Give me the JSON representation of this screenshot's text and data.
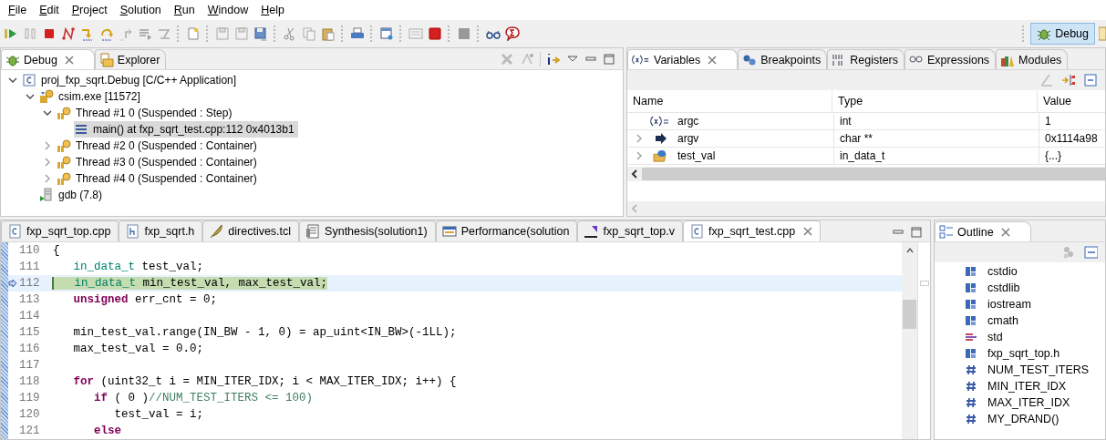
{
  "menu": [
    "File",
    "Edit",
    "Project",
    "Solution",
    "Run",
    "Window",
    "Help"
  ],
  "perspectives": [
    {
      "label": "Debug",
      "selected": true
    }
  ],
  "debug_view": {
    "tabs": [
      {
        "label": "Debug",
        "selected": true
      },
      {
        "label": "Explorer",
        "selected": false
      }
    ],
    "tree": [
      {
        "label": "proj_fxp_sqrt.Debug [C/C++ Application]",
        "kind": "launch",
        "expanded": true,
        "selected": false,
        "children": [
          {
            "label": "csim.exe [11572]",
            "kind": "process",
            "expanded": true,
            "selected": false,
            "children": [
              {
                "label": "Thread #1 0 (Suspended : Step)",
                "kind": "thread",
                "expanded": true,
                "selected": false,
                "children": [
                  {
                    "label": "main() at fxp_sqrt_test.cpp:112 0x4013b1",
                    "kind": "frame",
                    "selected": true
                  }
                ]
              },
              {
                "label": "Thread #2 0 (Suspended : Container)",
                "kind": "thread",
                "expanded": false,
                "selected": false
              },
              {
                "label": "Thread #3 0 (Suspended : Container)",
                "kind": "thread",
                "expanded": false,
                "selected": false
              },
              {
                "label": "Thread #4 0 (Suspended : Container)",
                "kind": "thread",
                "expanded": false,
                "selected": false
              }
            ]
          },
          {
            "label": "gdb (7.8)",
            "kind": "debugger",
            "selected": false
          }
        ]
      }
    ]
  },
  "variables_view": {
    "tabs": [
      {
        "label": "Variables",
        "kind": "variables",
        "selected": true
      },
      {
        "label": "Breakpoints",
        "kind": "breakpoints",
        "selected": false
      },
      {
        "label": "Registers",
        "kind": "registers",
        "selected": false
      },
      {
        "label": "Expressions",
        "kind": "expressions",
        "selected": false
      },
      {
        "label": "Modules",
        "kind": "modules",
        "selected": false
      }
    ],
    "columns": [
      "Name",
      "Type",
      "Value"
    ],
    "rows": [
      {
        "name": "argc",
        "type": "int",
        "value": "1",
        "kind": "scalar",
        "expandable": false
      },
      {
        "name": "argv",
        "type": "char **",
        "value": "0x1114a98",
        "kind": "pointer",
        "expandable": true
      },
      {
        "name": "test_val",
        "type": "in_data_t",
        "value": "{...}",
        "kind": "struct",
        "expandable": true
      }
    ]
  },
  "editor": {
    "tabs": [
      {
        "label": "fxp_sqrt_top.cpp",
        "kind": "cpp",
        "selected": false
      },
      {
        "label": "fxp_sqrt.h",
        "kind": "header",
        "selected": false
      },
      {
        "label": "directives.tcl",
        "kind": "tcl",
        "selected": false
      },
      {
        "label": "Synthesis(solution1)",
        "kind": "report",
        "selected": false
      },
      {
        "label": "Performance(solution",
        "kind": "performance",
        "selected": false
      },
      {
        "label": "fxp_sqrt_top.v",
        "kind": "rtl",
        "selected": false
      },
      {
        "label": "fxp_sqrt_test.cpp",
        "kind": "cpp",
        "selected": true
      }
    ],
    "lines": [
      {
        "number": "110",
        "current": false,
        "segments": [
          {
            "text": "{",
            "kind": "plain"
          }
        ]
      },
      {
        "number": "111",
        "current": false,
        "segments": [
          {
            "text": "   in_data_t",
            "kind": "type"
          },
          {
            "text": " test_val;",
            "kind": "plain"
          }
        ]
      },
      {
        "number": "112",
        "current": true,
        "segments": [
          {
            "text": "   in_data_t",
            "kind": "type"
          },
          {
            "text": " min_test_val, max_test_val;",
            "kind": "plain"
          }
        ]
      },
      {
        "number": "113",
        "current": false,
        "segments": [
          {
            "text": "   unsigned",
            "kind": "keyword"
          },
          {
            "text": " err_cnt = 0;",
            "kind": "plain"
          }
        ]
      },
      {
        "number": "114",
        "current": false
      },
      {
        "number": "115",
        "current": false,
        "segments": [
          {
            "text": "   min_test_val.range(IN_BW - 1, 0) = ap_uint<IN_BW>(-1LL);",
            "kind": "plain"
          }
        ]
      },
      {
        "number": "116",
        "current": false,
        "segments": [
          {
            "text": "   max_test_val = 0.0;",
            "kind": "plain"
          }
        ]
      },
      {
        "number": "117",
        "current": false
      },
      {
        "number": "118",
        "current": false,
        "segments": [
          {
            "text": "   for",
            "kind": "keyword"
          },
          {
            "text": " (uint32_t i = MIN_ITER_IDX; i < MAX_ITER_IDX; i++) {",
            "kind": "plain"
          }
        ]
      },
      {
        "number": "119",
        "current": false,
        "segments": [
          {
            "text": "      if",
            "kind": "keyword"
          },
          {
            "text": " ( 0 )",
            "kind": "plain"
          },
          {
            "text": "//NUM_TEST_ITERS <= 100)",
            "kind": "comment"
          }
        ]
      },
      {
        "number": "120",
        "current": false,
        "segments": [
          {
            "text": "         test_val = i;",
            "kind": "plain"
          }
        ]
      },
      {
        "number": "121",
        "current": false,
        "segments": [
          {
            "text": "      else",
            "kind": "keyword"
          }
        ]
      }
    ]
  },
  "outline_view": {
    "tabs": [
      {
        "label": "Outline",
        "selected": true
      }
    ],
    "items": [
      {
        "label": "cstdio",
        "kind": "include"
      },
      {
        "label": "cstdlib",
        "kind": "include"
      },
      {
        "label": "iostream",
        "kind": "include"
      },
      {
        "label": "cmath",
        "kind": "include"
      },
      {
        "label": "std",
        "kind": "namespace"
      },
      {
        "label": "fxp_sqrt_top.h",
        "kind": "include"
      },
      {
        "label": "NUM_TEST_ITERS",
        "kind": "macro"
      },
      {
        "label": "MIN_ITER_IDX",
        "kind": "macro"
      },
      {
        "label": "MAX_ITER_IDX",
        "kind": "macro"
      },
      {
        "label": "MY_DRAND()",
        "kind": "macro"
      }
    ]
  }
}
